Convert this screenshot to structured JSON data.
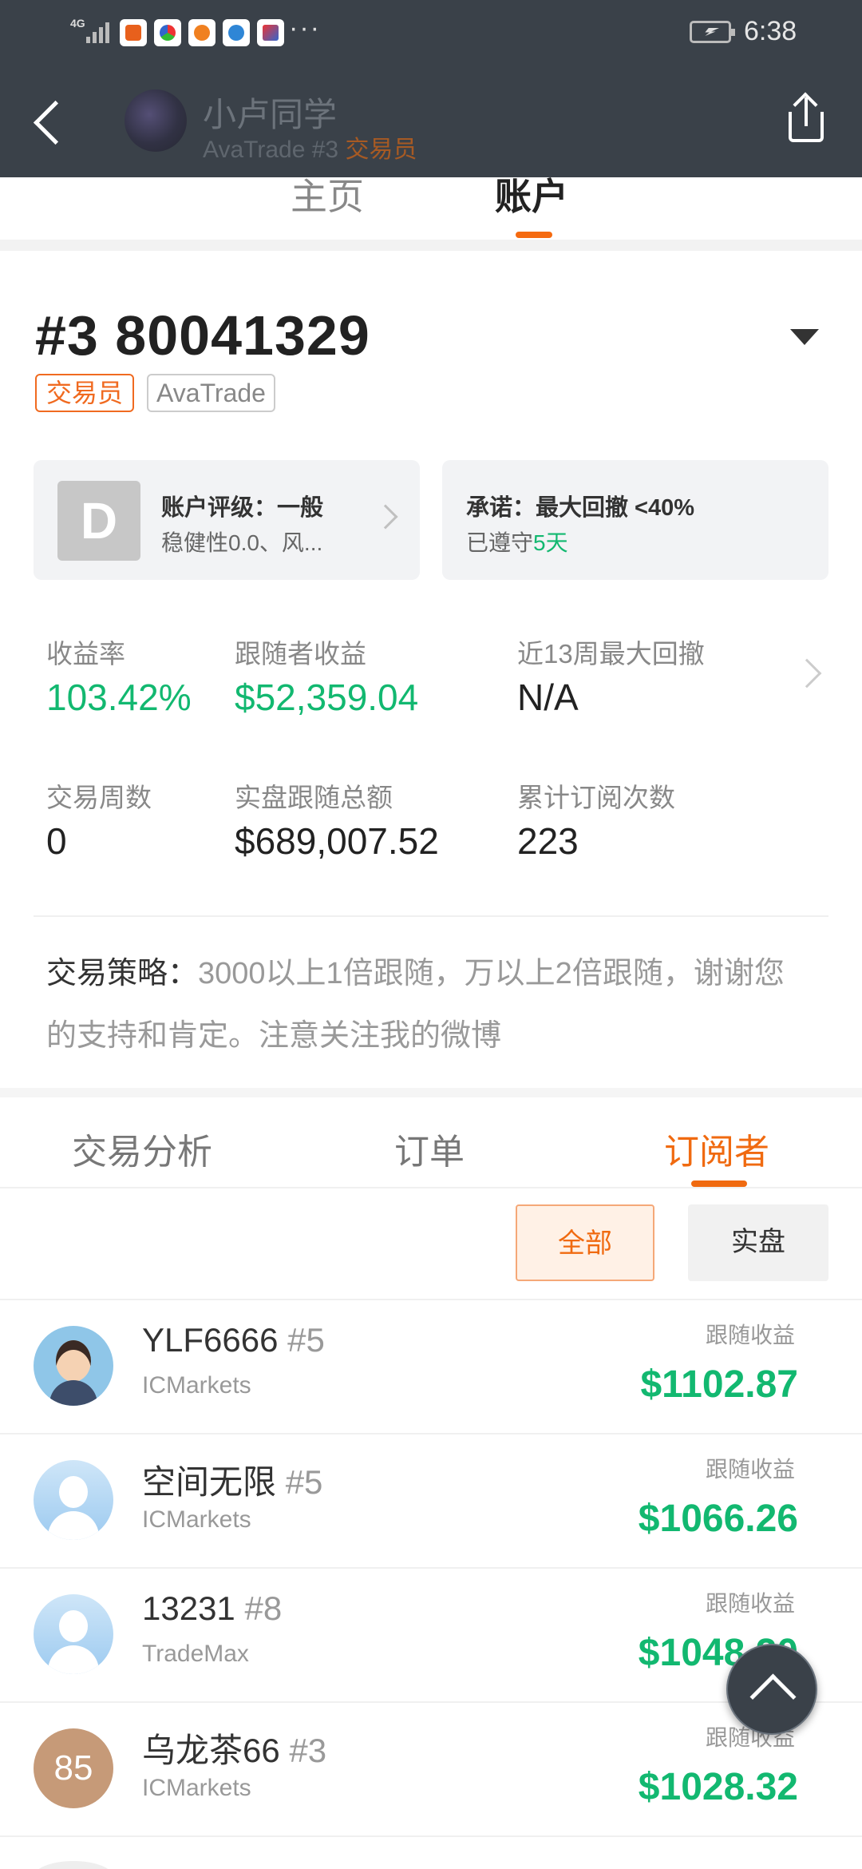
{
  "status_bar": {
    "network": "4G",
    "time": "6:38",
    "more": "···"
  },
  "header": {
    "trader_name": "小卢同学",
    "broker_line": "AvaTrade #3",
    "role": "交易员"
  },
  "main_tabs": [
    {
      "label": "主页"
    },
    {
      "label": "账户"
    }
  ],
  "account": {
    "number": "#3 80041329",
    "role_tag": "交易员",
    "broker_tag": "AvaTrade"
  },
  "rating_card": {
    "grade": "D",
    "title": "账户评级：一般",
    "desc": "稳健性0.0、风..."
  },
  "promise_card": {
    "title": "承诺：最大回撤 <40%",
    "prefix": "已遵守",
    "days": "5天"
  },
  "stats": {
    "return_label": "收益率",
    "return_value": "103.42%",
    "follower_profit_label": "跟随者收益",
    "follower_profit_value": "$52,359.04",
    "drawdown_label": "近13周最大回撤",
    "drawdown_value": "N/A",
    "weeks_label": "交易周数",
    "weeks_value": "0",
    "follow_total_label": "实盘跟随总额",
    "follow_total_value": "$689,007.52",
    "subs_label": "累计订阅次数",
    "subs_value": "223"
  },
  "strategy": {
    "key": "交易策略：",
    "text": "3000以上1倍跟随，万以上2倍跟随，谢谢您的支持和肯定。注意关注我的微博"
  },
  "sub_tabs": [
    {
      "label": "交易分析"
    },
    {
      "label": "订单"
    },
    {
      "label": "订阅者"
    }
  ],
  "filters": {
    "all": "全部",
    "live": "实盘"
  },
  "subscribers": [
    {
      "name": "YLF6666",
      "rank": "#5",
      "broker": "ICMarkets",
      "profit_label": "跟随收益",
      "profit": "$1102.87",
      "avatar": "photo"
    },
    {
      "name": "空间无限",
      "rank": "#5",
      "broker": "ICMarkets",
      "profit_label": "跟随收益",
      "profit": "$1066.26",
      "avatar": "default"
    },
    {
      "name": "13231",
      "rank": "#8",
      "broker": "TradeMax",
      "profit_label": "跟随收益",
      "profit": "$1048.20",
      "avatar": "default"
    },
    {
      "name": "乌龙茶66",
      "rank": "#3",
      "broker": "ICMarkets",
      "profit_label": "跟随收益",
      "profit": "$1028.32",
      "avatar": "85"
    }
  ],
  "colors": {
    "accent": "#f06a10",
    "positive": "#12b870",
    "header_bg": "#3a4149"
  }
}
